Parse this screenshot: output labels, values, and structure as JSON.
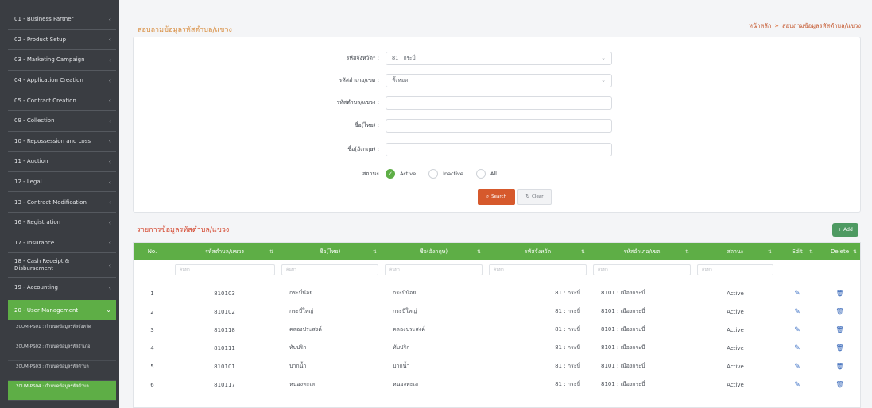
{
  "sidebar": {
    "items": [
      {
        "label": "01 - Business Partner"
      },
      {
        "label": "02 - Product Setup"
      },
      {
        "label": "03 - Marketing Campaign"
      },
      {
        "label": "04 - Application Creation"
      },
      {
        "label": "05 - Contract Creation"
      },
      {
        "label": "09 - Collection"
      },
      {
        "label": "10 - Repossession and Loss"
      },
      {
        "label": "11 - Auction"
      },
      {
        "label": "12 - Legal"
      },
      {
        "label": "13 - Contract Modification"
      },
      {
        "label": "16 - Registration"
      },
      {
        "label": "17 - Insurance"
      },
      {
        "label": "18 - Cash Receipt & Disbursement"
      },
      {
        "label": "19 - Accounting"
      },
      {
        "label": "20 - User Management"
      }
    ],
    "subitems": [
      {
        "label": "20UM-PS01 : กำหนดข้อมูลรหัสจังหวัด"
      },
      {
        "label": "20UM-PS02 : กำหนดข้อมูลรหัสอำเภอ"
      },
      {
        "label": "20UM-PS03 : กำหนดข้อมูลรหัสตำบล"
      },
      {
        "label": "20UM-PS04 : กำหนดข้อมูลรหัสตำบล"
      }
    ]
  },
  "header": {
    "title": "สอบถามข้อมูลรหัสตำบล/แขวง",
    "breadcrumb_home": "หน้าหลัก",
    "breadcrumb_sep": "»",
    "breadcrumb_current": "สอบถามข้อมูลรหัสตำบล/แขวง"
  },
  "search": {
    "province_label": "รหัสจังหวัด* :",
    "province_value": "81 : กระบี่",
    "district_label": "รหัสอำเภอ/เขต :",
    "district_value": "ทั้งหมด",
    "subdistrict_label": "รหัสตำบล/แขวง :",
    "subdistrict_value": "",
    "name_th_label": "ชื่อ(ไทย) :",
    "name_th_value": "",
    "name_en_label": "ชื่อ(อังกฤษ) :",
    "name_en_value": "",
    "status_label": "สถานะ",
    "status_options": [
      "Active",
      "Inactive",
      "All"
    ],
    "search_button": "Search",
    "clear_button": "Clear"
  },
  "list": {
    "title": "รายการข้อมูลรหัสตำบล/แขวง",
    "add_button": "+ Add",
    "columns": [
      "No.",
      "รหัสตำบล/แขวง",
      "ชื่อ(ไทย)",
      "ชื่อ(อังกฤษ)",
      "รหัสจังหวัด",
      "รหัสอำเภอ/เขต",
      "สถานะ",
      "Edit",
      "Delete"
    ],
    "filter_placeholder": "ค้นหา",
    "rows": [
      {
        "no": "1",
        "code": "810103",
        "name_th": "กระบี่น้อย",
        "name_en": "กระบี่น้อย",
        "province": "81 : กระบี่",
        "district": "8101 : เมืองกระบี่",
        "status": "Active"
      },
      {
        "no": "2",
        "code": "810102",
        "name_th": "กระบี่ใหญ่",
        "name_en": "กระบี่ใหญ่",
        "province": "81 : กระบี่",
        "district": "8101 : เมืองกระบี่",
        "status": "Active"
      },
      {
        "no": "3",
        "code": "810118",
        "name_th": "คลองประสงค์",
        "name_en": "คลองประสงค์",
        "province": "81 : กระบี่",
        "district": "8101 : เมืองกระบี่",
        "status": "Active"
      },
      {
        "no": "4",
        "code": "810111",
        "name_th": "ทับปริก",
        "name_en": "ทับปริก",
        "province": "81 : กระบี่",
        "district": "8101 : เมืองกระบี่",
        "status": "Active"
      },
      {
        "no": "5",
        "code": "810101",
        "name_th": "ปากน้ำ",
        "name_en": "ปากน้ำ",
        "province": "81 : กระบี่",
        "district": "8101 : เมืองกระบี่",
        "status": "Active"
      },
      {
        "no": "6",
        "code": "810117",
        "name_th": "หนองทะเล",
        "name_en": "หนองทะเล",
        "province": "81 : กระบี่",
        "district": "8101 : เมืองกระบี่",
        "status": "Active"
      }
    ]
  },
  "colors": {
    "sidebar_bg": "#3a3d42",
    "accent_green": "#5eae46",
    "title_orange": "#d88c3e",
    "search_button": "#d6592c",
    "list_title_red": "#d4452c"
  }
}
